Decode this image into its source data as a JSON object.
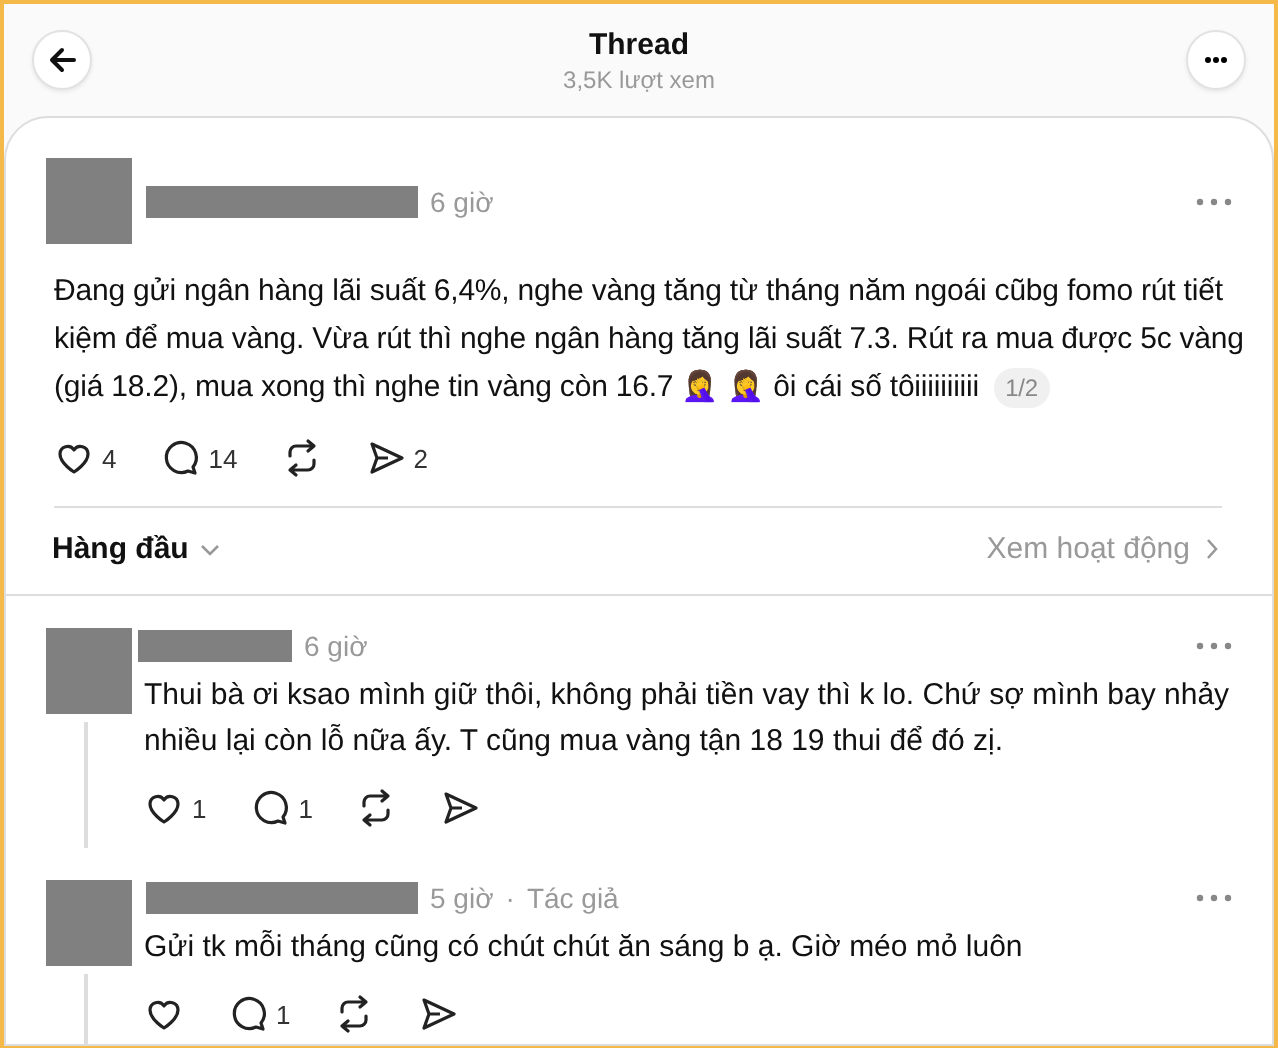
{
  "header": {
    "title": "Thread",
    "views": "3,5K lượt xem"
  },
  "post": {
    "time": "6 giờ",
    "text": "Đang gửi ngân hàng lãi suất 6,4%, nghe vàng tăng từ tháng năm ngoái cũbg fomo rút tiết kiệm để mua vàng. Vừa rút thì nghe ngân hàng tăng lãi suất 7.3. Rút ra mua được 5c vàng (giá 18.2), mua xong thì nghe tin vàng còn 16.7 🤦‍♀️ 🤦‍♀️ ôi cái số tôiiiiiiiiii",
    "page_badge": "1/2",
    "actions": [
      {
        "kind": "like",
        "count": "4"
      },
      {
        "kind": "reply",
        "count": "14"
      },
      {
        "kind": "repost"
      },
      {
        "kind": "share",
        "count": "2"
      }
    ]
  },
  "sort": {
    "label": "Hàng đầu",
    "activity_link": "Xem hoạt động"
  },
  "replies": [
    {
      "time": "6 giờ",
      "text": "Thui bà ơi ksao mình giữ thôi, không phải tiền vay thì k lo. Chứ sợ mình bay nhảy nhiều lại còn lỗ nữa ấy. T cũng mua vàng tận 18 19 thui để đó zị.",
      "actions": [
        {
          "kind": "like",
          "count": "1"
        },
        {
          "kind": "reply",
          "count": "1"
        },
        {
          "kind": "repost"
        },
        {
          "kind": "share"
        }
      ]
    },
    {
      "time": "5 giờ",
      "separator": "·",
      "author_tag": "Tác giả",
      "text": "Gửi tk mỗi tháng cũng có chút chút ăn sáng b ạ. Giờ méo mỏ luôn",
      "actions": [
        {
          "kind": "like"
        },
        {
          "kind": "reply",
          "count": "1"
        },
        {
          "kind": "repost"
        },
        {
          "kind": "share"
        }
      ]
    }
  ]
}
